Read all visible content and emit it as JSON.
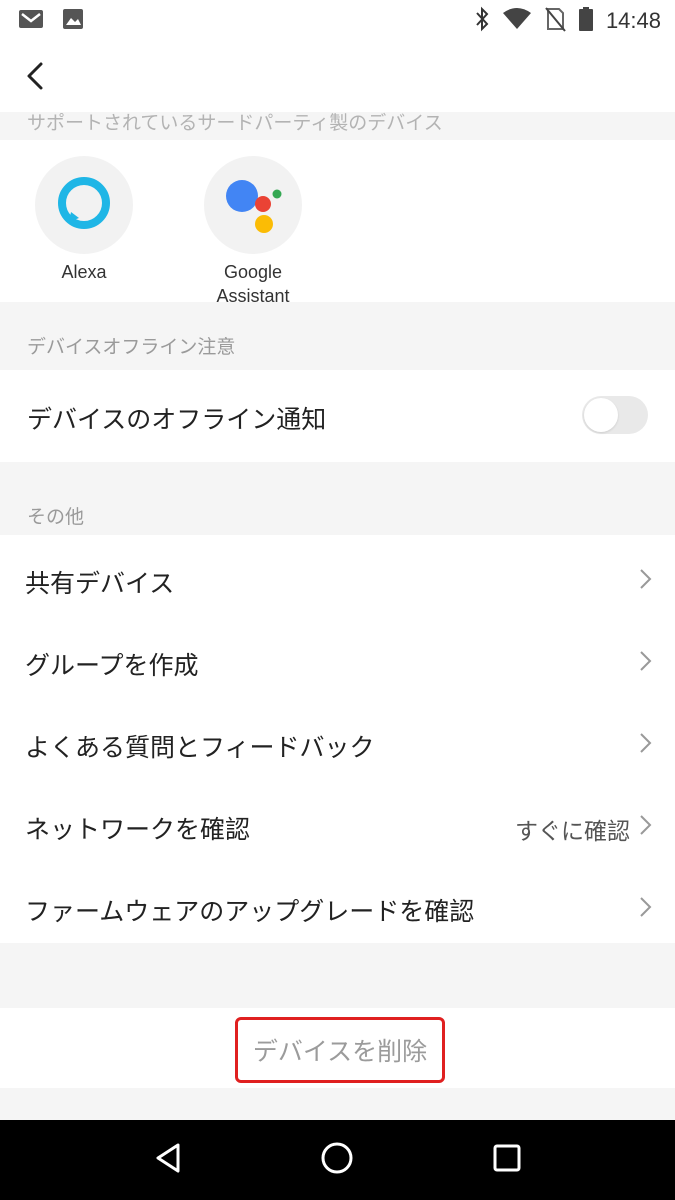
{
  "status_bar": {
    "time": "14:48",
    "icons": [
      "gmail-icon",
      "image-icon",
      "bluetooth-icon",
      "wifi-icon",
      "no-sim-icon",
      "battery-icon"
    ]
  },
  "header": {
    "back_icon": "chevron-left-icon"
  },
  "sections": {
    "third_party_label": "サポートされているサードパーティ製のデバイス",
    "offline_label": "デバイスオフライン注意",
    "other_label": "その他"
  },
  "third_party": [
    {
      "name": "Alexa",
      "icon": "alexa-icon"
    },
    {
      "name_line1": "Google",
      "name_line2": "Assistant",
      "icon": "google-assistant-icon"
    }
  ],
  "offline": {
    "title": "デバイスのオフライン通知",
    "toggle_on": false
  },
  "other_items": [
    {
      "label": "共有デバイス",
      "value": ""
    },
    {
      "label": "グループを作成",
      "value": ""
    },
    {
      "label": "よくある質問とフィードバック",
      "value": ""
    },
    {
      "label": "ネットワークを確認",
      "value": "すぐに確認"
    },
    {
      "label": "ファームウェアのアップグレードを確認",
      "value": ""
    }
  ],
  "delete_button": "デバイスを削除",
  "colors": {
    "alexa_blue": "#1fb6e6",
    "google_blue": "#4285f4",
    "google_red": "#ea4335",
    "google_yellow": "#fbbc05",
    "google_green": "#34a853",
    "delete_border": "#e02020"
  }
}
